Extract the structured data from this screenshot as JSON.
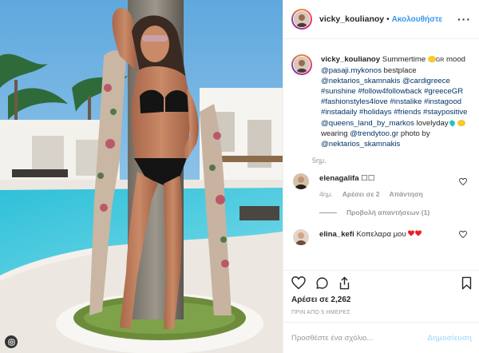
{
  "header": {
    "username": "vicky_koulianoy",
    "separator": "•",
    "follow_label": "Ακολουθήστε",
    "more_label": "···"
  },
  "caption": {
    "username": "vicky_koulianoy",
    "segments": [
      {
        "t": "Summertime "
      },
      {
        "icon": "sun-emoji"
      },
      {
        "t": "GR",
        "small": true
      },
      {
        "t": " mood "
      },
      {
        "t": "@pasaji.mykonos",
        "tag": true
      },
      {
        "t": " bestplace "
      },
      {
        "t": "@nektarios_skamnakis",
        "tag": true
      },
      {
        "t": " "
      },
      {
        "t": "@cardigreece",
        "tag": true
      },
      {
        "t": " "
      },
      {
        "t": "#sunshine",
        "tag": true
      },
      {
        "t": " "
      },
      {
        "t": "#follow4followback",
        "tag": true
      },
      {
        "t": " "
      },
      {
        "t": "#greeceGR",
        "tag": true
      },
      {
        "t": " "
      },
      {
        "t": "#fashionstyles4love",
        "tag": true
      },
      {
        "t": " "
      },
      {
        "t": "#instalike",
        "tag": true
      },
      {
        "t": " "
      },
      {
        "t": "#instagood",
        "tag": true
      },
      {
        "t": " "
      },
      {
        "t": "#instadaily",
        "tag": true
      },
      {
        "t": " "
      },
      {
        "t": "#holidays",
        "tag": true
      },
      {
        "t": " "
      },
      {
        "t": "#friends",
        "tag": true
      },
      {
        "t": " "
      },
      {
        "t": "#staypositive",
        "tag": true
      },
      {
        "t": " "
      },
      {
        "t": "@queens_land_by_markos",
        "tag": true
      },
      {
        "t": " lovelyday"
      },
      {
        "icon": "blue-heart-emoji"
      },
      {
        "t": " "
      },
      {
        "icon": "sun-emoji"
      },
      {
        "t": "wearing "
      },
      {
        "t": "@trendytoo.gr",
        "tag": true
      },
      {
        "t": " photo by "
      },
      {
        "t": "@nektarios_skamnakis",
        "tag": true
      }
    ],
    "time": "5ημ."
  },
  "comments": [
    {
      "username": "elenagalifa",
      "text": "☐☐",
      "time": "4ημ.",
      "likes": "Αρέσει σε 2",
      "reply_label": "Απάντηση",
      "view_replies": "Προβολή απαντήσεων (1)"
    },
    {
      "username": "elina_kefi",
      "text": "Κοπελαρα μου",
      "emoji": "red-hearts-emoji"
    }
  ],
  "actions": {
    "likes": "Αρέσει σε 2,262",
    "date": "ΠΡΙΝ ΑΠΟ 5 ΗΜΕΡΕΣ"
  },
  "add_comment": {
    "placeholder": "Προσθέστε ένα σχόλιο...",
    "post_label": "Δημοσίευση"
  },
  "colors": {
    "link": "#3897f0",
    "tag": "#003569",
    "muted": "#999999",
    "post_disabled": "#b2dffc",
    "heart_red": "#ed1c24"
  },
  "icons": {
    "photo_corner": "instagram-glyph-icon",
    "like": "heart-icon",
    "comment": "comment-bubble-icon",
    "share": "share-upload-icon",
    "save": "bookmark-icon"
  }
}
